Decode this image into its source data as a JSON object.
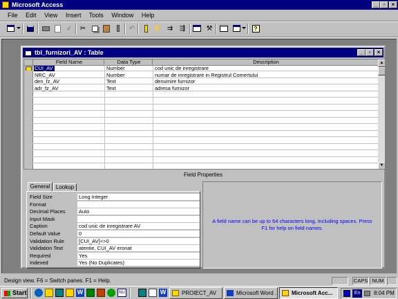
{
  "app": {
    "title": "Microsoft Access"
  },
  "menu": [
    "File",
    "Edit",
    "View",
    "Insert",
    "Tools",
    "Window",
    "Help"
  ],
  "toolbar_icons": [
    "view-design-icon",
    "save-icon",
    "print-icon",
    "print-preview-icon",
    "spelling-icon",
    "cut-icon",
    "copy-icon",
    "paste-icon",
    "format-painter-icon",
    "undo-icon",
    "primary-key-icon",
    "indexes-icon",
    "insert-rows-icon",
    "delete-rows-icon",
    "properties-icon",
    "build-icon",
    "database-window-icon",
    "new-object-icon",
    "help-icon"
  ],
  "table_window": {
    "title": "tbl_furnizori_AV : Table",
    "headers": [
      "Field Name",
      "Data Type",
      "Description"
    ],
    "rows": [
      {
        "field": "CUI_AV",
        "type": "Number",
        "desc": "cod unic de inregistrare"
      },
      {
        "field": "NRC_AV",
        "type": "Number",
        "desc": "numar de inregistrare in Registrul Comertului"
      },
      {
        "field": "den_fz_AV",
        "type": "Text",
        "desc": "denumire furnizor"
      },
      {
        "field": "adr_fz_AV",
        "type": "Text",
        "desc": "adresa furnizor"
      }
    ],
    "field_properties_title": "Field Properties",
    "tabs": [
      "General",
      "Lookup"
    ],
    "properties": [
      {
        "label": "Field Size",
        "value": "Long Integer"
      },
      {
        "label": "Format",
        "value": ""
      },
      {
        "label": "Decimal Places",
        "value": "Auto"
      },
      {
        "label": "Input Mask",
        "value": ""
      },
      {
        "label": "Caption",
        "value": "cod unic de inregistrare AV"
      },
      {
        "label": "Default Value",
        "value": "0"
      },
      {
        "label": "Validation Rule",
        "value": "[CUI_AV]<>0"
      },
      {
        "label": "Validation Text",
        "value": "atentie, CUI_AV eronat"
      },
      {
        "label": "Required",
        "value": "Yes"
      },
      {
        "label": "Indexed",
        "value": "Yes (No Duplicates)"
      }
    ],
    "help_text": "A field name can be up to 64 characters long, including spaces.  Press F1 for help on field names."
  },
  "status": {
    "text": "Design view.  F6 = Switch panes.  F1 = Help.",
    "caps": "CAPS",
    "num": "NUM"
  },
  "taskbar": {
    "start": "Start",
    "tasks": [
      "PROIECT_AV",
      "Microsoft Word ...",
      "Microsoft Acc..."
    ],
    "tray_lang": "En",
    "clock": "8:04 PM"
  },
  "colors": {
    "titlebar": "#000080",
    "desktop": "#008080",
    "face": "#c0c0c0",
    "help_text": "#0000ff"
  }
}
